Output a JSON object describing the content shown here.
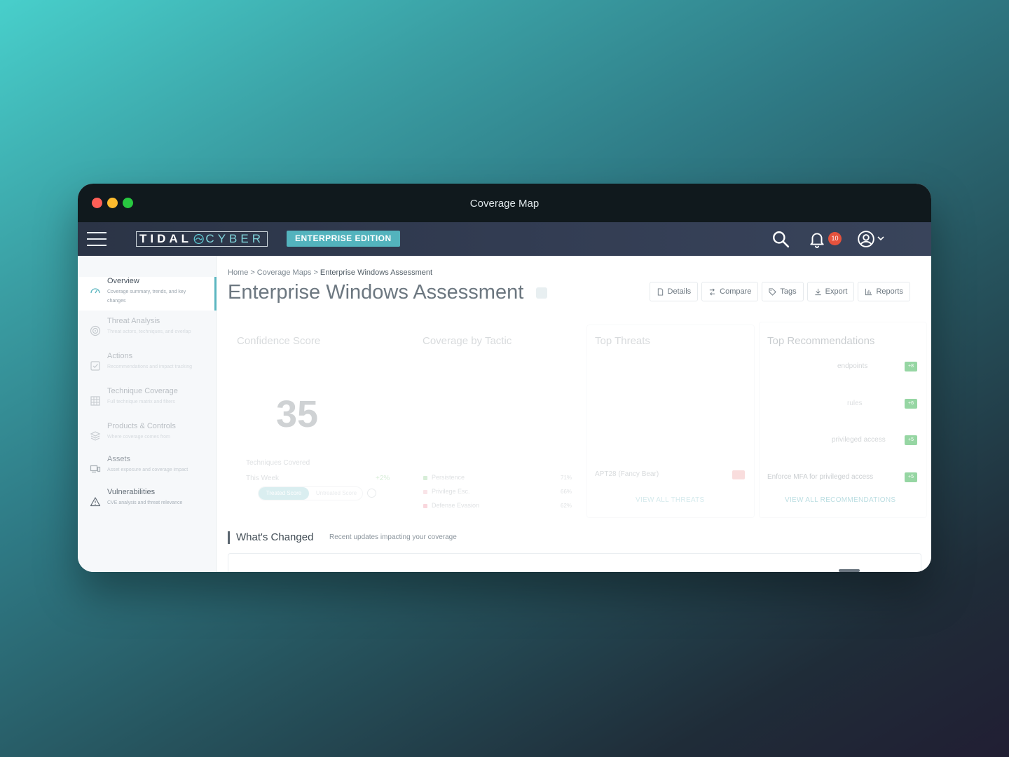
{
  "window": {
    "title": "Coverage Map"
  },
  "appbar": {
    "logo_left": "TIDAL",
    "logo_right": "CYBER",
    "edition": "ENTERPRISE EDITION",
    "notifications_count": "10"
  },
  "sidebar": {
    "items": [
      {
        "label": "Overview",
        "desc": "Coverage summary, trends, and key changes"
      },
      {
        "label": "Threat Analysis",
        "desc": "Threat actors, techniques, and overlap"
      },
      {
        "label": "Actions",
        "desc": "Recommendations and impact tracking"
      },
      {
        "label": "Technique Coverage",
        "desc": "Full technique matrix and filters"
      },
      {
        "label": "Products & Controls",
        "desc": "Where coverage comes from"
      },
      {
        "label": "Assets",
        "desc": "Asset exposure and coverage impact"
      },
      {
        "label": "Vulnerabilities",
        "desc": "CVE analysis and threat relevance"
      }
    ]
  },
  "breadcrumb": {
    "home": "Home",
    "level2": "Coverage Maps",
    "current": "Enterprise Windows Assessment",
    "sep": ">"
  },
  "page": {
    "title": "Enterprise Windows Assessment"
  },
  "actions": {
    "details": "Details",
    "compare": "Compare",
    "tags": "Tags",
    "export": "Export",
    "reports": "Reports"
  },
  "cards": {
    "confidence": {
      "title": "Confidence Score",
      "score": "35",
      "techniques_label": "Techniques Covered",
      "week_label": "This Week",
      "week_delta": "+2%",
      "toggle_on": "Treated Score",
      "toggle_off": "Untreated Score"
    },
    "coverage": {
      "title": "Coverage by Tactic",
      "legend": [
        {
          "label": "Persistence",
          "pct": "71%",
          "color": "#4caf50"
        },
        {
          "label": "Privilege Esc.",
          "pct": "66%",
          "color": "#e88a9a"
        },
        {
          "label": "Defense Evasion",
          "pct": "62%",
          "color": "#e84d6a"
        }
      ]
    },
    "threats": {
      "title": "Top Threats",
      "row_last": "APT28 (Fancy Bear)",
      "view_all": "VIEW ALL THREATS"
    },
    "recommendations": {
      "title": "Top Recommendations",
      "rows": [
        {
          "text": "endpoints",
          "badge": "+8"
        },
        {
          "text": "rules",
          "badge": "+6"
        },
        {
          "text": "privileged access",
          "badge": "+5"
        },
        {
          "text": "Enforce MFA for privileged access",
          "badge": "+5"
        }
      ],
      "view_all": "VIEW ALL RECOMMENDATIONS"
    }
  },
  "section": {
    "title": "What's Changed",
    "subtitle": "Recent updates impacting your coverage"
  },
  "colors": {
    "accent": "#5bb6c0",
    "appbar": "#323c52",
    "badge": "#e5523d"
  }
}
